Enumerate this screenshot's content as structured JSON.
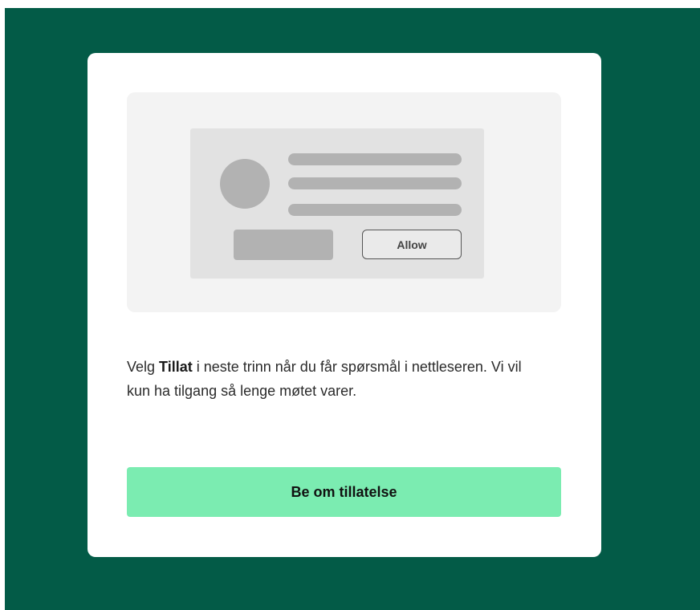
{
  "illustration": {
    "allow_button_label": "Allow"
  },
  "message": {
    "part1": "Velg ",
    "bold": "Tillat",
    "part2": " i neste trinn når du får spørsmål i nettleseren. Vi vil kun ha tilgang så lenge møtet varer."
  },
  "cta": {
    "label": "Be om tillatelse"
  },
  "colors": {
    "background": "#035b47",
    "card": "#ffffff",
    "cta": "#7becb1"
  }
}
